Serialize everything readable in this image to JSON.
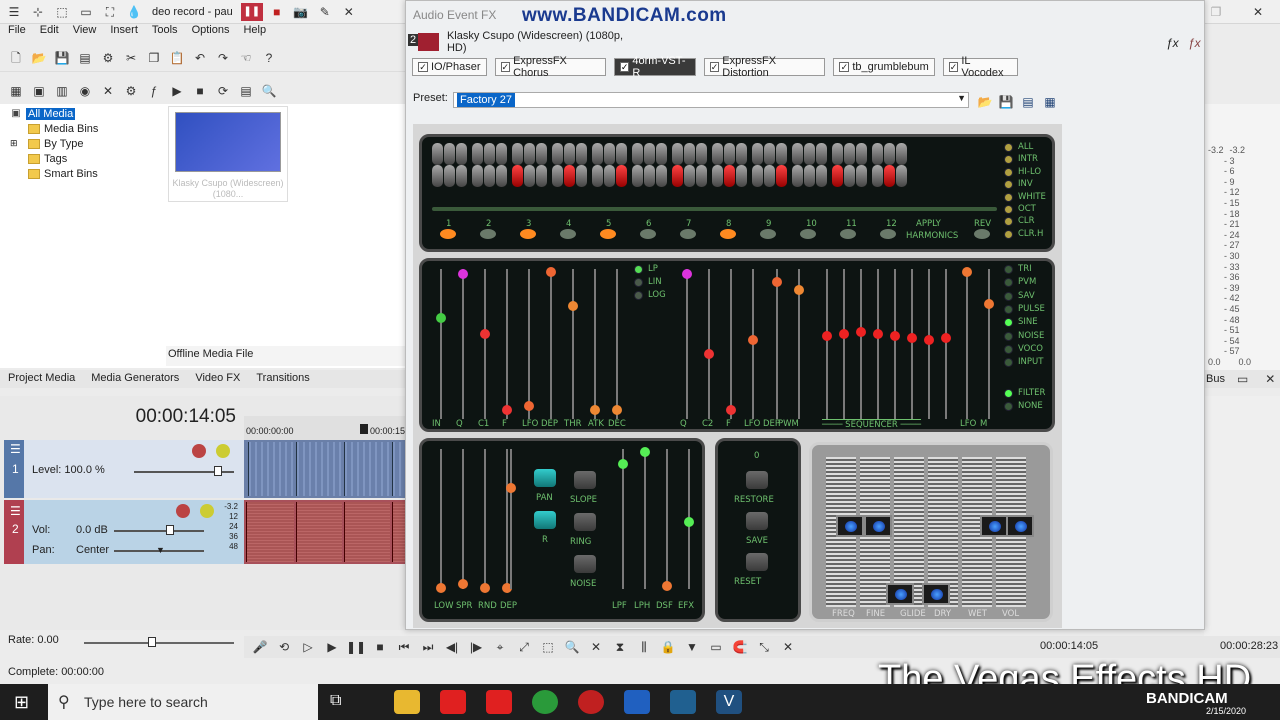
{
  "app": {
    "window_title": "deo record - pau",
    "menu": [
      "File",
      "Edit",
      "View",
      "Insert",
      "Tools",
      "Options",
      "Help"
    ]
  },
  "media_tree": {
    "items": [
      "All Media",
      "Media Bins",
      "By Type",
      "Tags",
      "Smart Bins"
    ],
    "thumb_caption": "Klasky Csupo (Widescreen) (1080...",
    "offline_label": "Offline Media File"
  },
  "tabs": [
    "Project Media",
    "Media Generators",
    "Video FX",
    "Transitions"
  ],
  "timeline": {
    "timecode": "00:00:14:05",
    "ruler_start": "00:00:00:00",
    "ruler_mark": "00:00:15",
    "track1": {
      "number": "1",
      "level": "Level: 100.0 %"
    },
    "track2": {
      "number": "2",
      "vol_label": "Vol:",
      "vol_value": "0.0 dB",
      "pan_label": "Pan:",
      "pan_value": "Center"
    },
    "db_marks": [
      "-3.2",
      "12",
      "24",
      "36",
      "48"
    ],
    "rate": "Rate: 0.00",
    "status": "Complete: 00:00:00",
    "transport_time": "00:00:14:05",
    "transport_time2": "00:00:28:23"
  },
  "fx": {
    "title": "Audio Event FX",
    "watermark": "www.BANDICAM.com",
    "track_number": "2",
    "track_name": "Klasky Csupo (Widescreen) (1080p, HD)",
    "chain": [
      "IO/Phaser",
      "ExpressFX Chorus",
      "4orm-VST-R",
      "ExpressFX Distortion",
      "tb_grumblebum",
      "IL Vocodex"
    ],
    "preset_label": "Preset:",
    "preset_value": "Factory 27"
  },
  "synth": {
    "top_numbers": [
      "1",
      "2",
      "3",
      "4",
      "5",
      "6",
      "7",
      "8",
      "9",
      "10",
      "11",
      "12"
    ],
    "apply_label": "APPLY",
    "harmonics_label": "HARMONICS",
    "rev_label": "REV",
    "right_top": [
      "ALL",
      "INTR",
      "HI-LO",
      "INV",
      "WHITE",
      "OCT",
      "CLR",
      "CLR.H"
    ],
    "mid_bottom": [
      "IN",
      "Q",
      "C1",
      "F",
      "LFO DEP",
      "THR",
      "ATK",
      "DEC",
      "Q",
      "C2",
      "F",
      "LFO DEP",
      "PWM",
      "LFO",
      "M"
    ],
    "sequencer_label": "SEQUENCER",
    "filter_modes": [
      "LP",
      "LIN",
      "LOG"
    ],
    "waves": [
      "TRI",
      "PVM",
      "SAV",
      "PULSE",
      "SINE",
      "NOISE",
      "VOCO",
      "INPUT"
    ],
    "filter_labels": [
      "FILTER",
      "NONE"
    ],
    "bottom_left_labels": [
      "LOW",
      "SPR",
      "RND",
      "DEP"
    ],
    "bottom_left_buttons": [
      "PAN",
      "R",
      "SLOPE",
      "RING",
      "NOISE"
    ],
    "bottom_left_right_labels": [
      "LPF",
      "LPH",
      "DSF",
      "EFX"
    ],
    "center_value": "0",
    "center_buttons": [
      "RESTORE",
      "SAVE",
      "RESET"
    ],
    "right_labels": [
      "FREQ",
      "FINE",
      "GLIDE",
      "DRY",
      "WET",
      "VOL"
    ]
  },
  "meter": {
    "top": [
      "-3.2",
      "-3.2"
    ],
    "scale": [
      "3",
      "6",
      "9",
      "12",
      "15",
      "18",
      "21",
      "24",
      "27",
      "30",
      "33",
      "36",
      "39",
      "42",
      "45",
      "48",
      "51",
      "54",
      "57"
    ],
    "bottom": [
      "0.0",
      "0.0"
    ],
    "bus_label": "Bus"
  },
  "taskbar": {
    "search_placeholder": "Type here to search",
    "date": "2/15/2020",
    "overlay_text": "The Vegas Effects HD",
    "bandicam": "BANDICAM"
  }
}
